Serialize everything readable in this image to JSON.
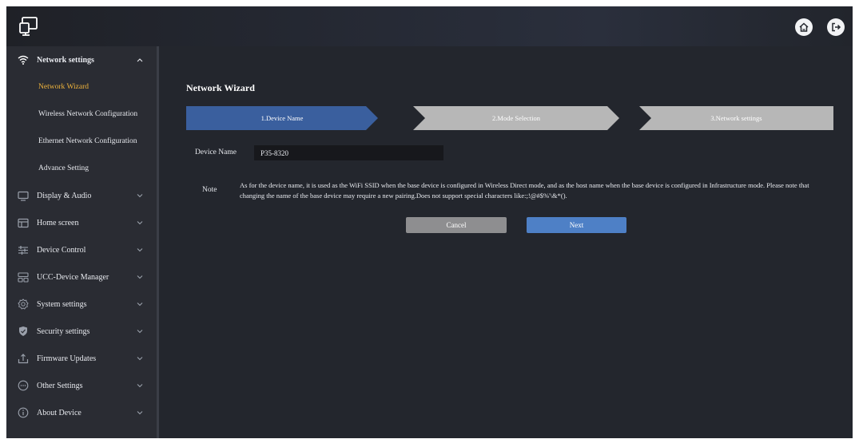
{
  "sidebar": {
    "section": {
      "label": "Network settings"
    },
    "sub_items": [
      {
        "label": "Network Wizard"
      },
      {
        "label": "Wireless Network Configuration"
      },
      {
        "label": "Ethernet Network Configuration"
      },
      {
        "label": "Advance Setting"
      }
    ],
    "items": [
      {
        "label": "Display & Audio",
        "icon": "monitor-icon"
      },
      {
        "label": "Home screen",
        "icon": "home-screen-icon"
      },
      {
        "label": "Device Control",
        "icon": "sliders-icon"
      },
      {
        "label": "UCC-Device Manager",
        "icon": "device-manager-icon"
      },
      {
        "label": "System settings",
        "icon": "gear-icon"
      },
      {
        "label": "Security settings",
        "icon": "shield-icon"
      },
      {
        "label": "Firmware Updates",
        "icon": "upload-icon"
      },
      {
        "label": "Other Settings",
        "icon": "more-icon"
      },
      {
        "label": "About Device",
        "icon": "info-icon"
      }
    ]
  },
  "main": {
    "title": "Network Wizard",
    "steps": [
      {
        "label": "1.Device Name"
      },
      {
        "label": "2.Mode Selection"
      },
      {
        "label": "3.Network settings"
      }
    ],
    "device_name": {
      "label": "Device Name",
      "value": "P35-8320"
    },
    "note": {
      "label": "Note",
      "text": "As for the device name, it is used as the WiFi SSID when the base device is configured in Wireless Direct mode, and as the host name when the base device is configured in Infrastructure mode. Please note that changing the name of the base device may require a new pairing.Does not support special characters like:;!@#$%'\\&*()."
    },
    "buttons": {
      "cancel": "Cancel",
      "next": "Next"
    }
  },
  "colors": {
    "accent": "#f0b43c",
    "step_active": "#3a5f9e",
    "step_inactive": "#b7b7b7",
    "next_button": "#4e80c6",
    "cancel_button": "#8e8e90"
  }
}
